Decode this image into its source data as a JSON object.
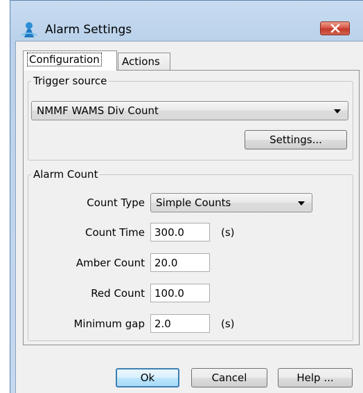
{
  "window": {
    "title": "Alarm Settings"
  },
  "tabs": [
    {
      "label": "Configuration",
      "selected": true
    },
    {
      "label": "Actions",
      "selected": false
    }
  ],
  "trigger_source": {
    "legend": "Trigger source",
    "selected": "NMMF WAMS Div Count",
    "settings_label": "Settings..."
  },
  "alarm_count": {
    "legend": "Alarm Count",
    "count_type": {
      "label": "Count Type",
      "selected": "Simple Counts"
    },
    "count_time": {
      "label": "Count Time",
      "value": "300.0",
      "unit": "(s)"
    },
    "amber_count": {
      "label": "Amber Count",
      "value": "20.0"
    },
    "red_count": {
      "label": "Red Count",
      "value": "100.0"
    },
    "minimum_gap": {
      "label": "Minimum gap",
      "value": "2.0",
      "unit": "(s)"
    }
  },
  "buttons": {
    "ok": "Ok",
    "cancel": "Cancel",
    "help": "Help ..."
  },
  "colors": {
    "title_gradient": "#c8dcf1",
    "close_button": "#c94a38",
    "default_button_border": "#3c7fb1"
  }
}
